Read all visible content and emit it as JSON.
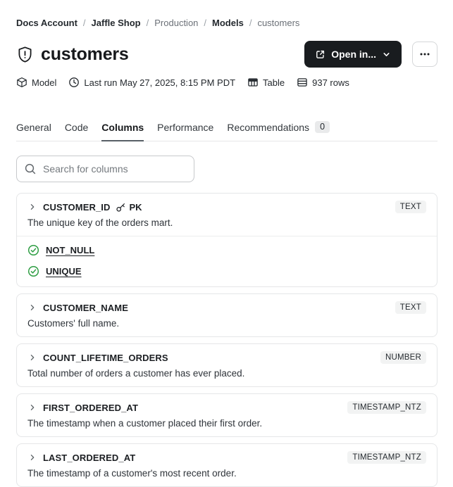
{
  "breadcrumb": {
    "items": [
      {
        "label": "Docs Account",
        "bold": true
      },
      {
        "sep": "/",
        "label": "Jaffle Shop",
        "bold": true
      },
      {
        "sep": "/",
        "label": "Production"
      },
      {
        "sep": "/",
        "label": "Models",
        "bold": true
      },
      {
        "sep": "/",
        "label": "customers"
      }
    ]
  },
  "header": {
    "title": "customers",
    "open_in_label": "Open in..."
  },
  "meta": {
    "items": [
      {
        "icon": "model-cube-icon",
        "label": "Model"
      },
      {
        "icon": "clock-icon",
        "label": "Last run May 27, 2025, 8:15 PM PDT"
      },
      {
        "icon": "table-icon",
        "label": "Table"
      },
      {
        "icon": "database-rows-icon",
        "label": "937 rows"
      }
    ]
  },
  "tabs": {
    "items": [
      {
        "label": "General"
      },
      {
        "label": "Code"
      },
      {
        "label": "Columns",
        "active": true
      },
      {
        "label": "Performance"
      },
      {
        "label": "Recommendations",
        "badge": "0"
      }
    ]
  },
  "search": {
    "placeholder": "Search for columns",
    "value": ""
  },
  "columns": [
    {
      "name": "CUSTOMER_ID",
      "pk": "PK",
      "type": "TEXT",
      "description": "The unique key of the orders mart.",
      "tests": [
        "NOT_NULL",
        "UNIQUE"
      ]
    },
    {
      "name": "CUSTOMER_NAME",
      "type": "TEXT",
      "description": "Customers' full name."
    },
    {
      "name": "COUNT_LIFETIME_ORDERS",
      "type": "NUMBER",
      "description": "Total number of orders a customer has ever placed."
    },
    {
      "name": "FIRST_ORDERED_AT",
      "type": "TIMESTAMP_NTZ",
      "description": "The timestamp when a customer placed their first order."
    },
    {
      "name": "LAST_ORDERED_AT",
      "type": "TIMESTAMP_NTZ",
      "description": "The timestamp of a customer's most recent order."
    }
  ],
  "icons": {
    "shield-alert-icon": "shield with exclamation",
    "external-link-icon": "box with outgoing arrow",
    "chevron-down-icon": "⌄",
    "ellipsis-icon": "•••",
    "model-cube-icon": "3d cube",
    "clock-icon": "clock face",
    "table-icon": "grid table",
    "database-rows-icon": "stacked rows",
    "search-icon": "magnifier",
    "chevron-right-icon": "›",
    "key-icon": "primary key",
    "check-circle-icon": "green check in circle"
  },
  "colors": {
    "button_dark_bg": "#191c1f",
    "test_pass_green": "#2f9e44",
    "type_badge_bg": "#f2f3f3",
    "tab_badge_bg": "#e9eaeb",
    "card_border": "#e5e6e8"
  }
}
